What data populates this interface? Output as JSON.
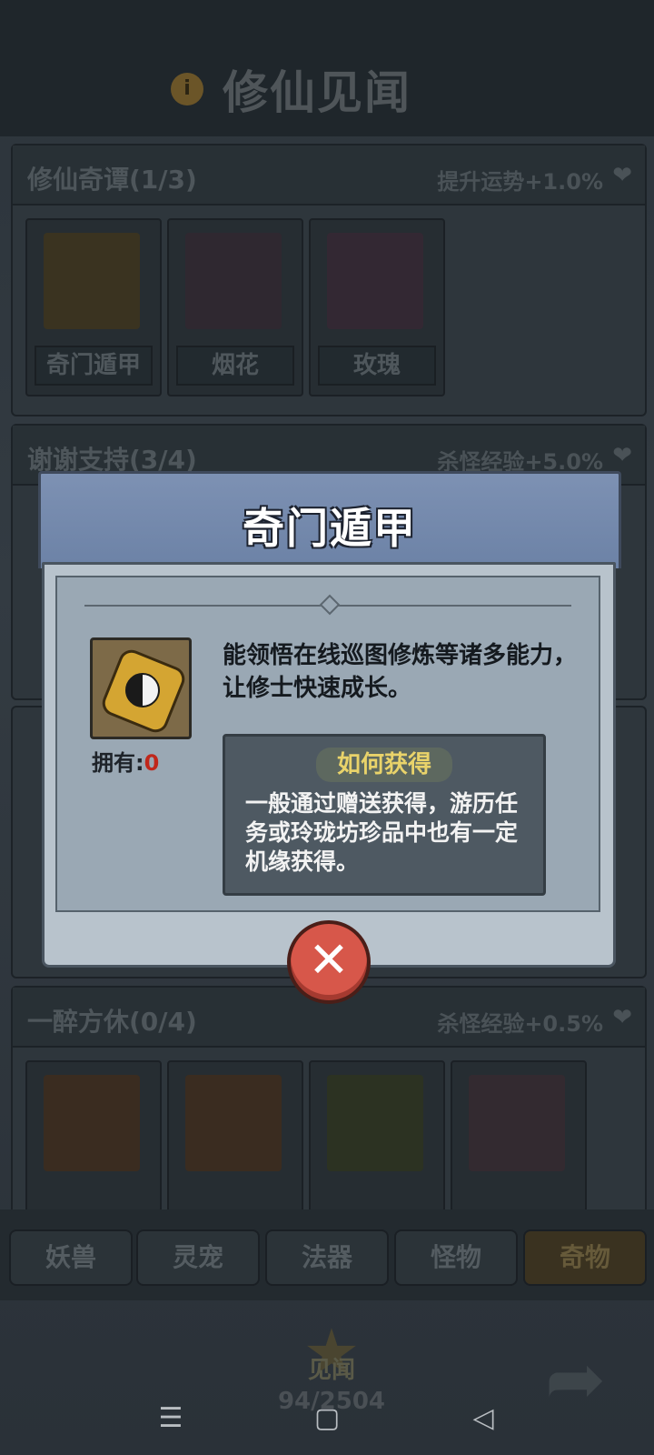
{
  "header": {
    "title": "修仙见闻",
    "info_icon": "info-icon"
  },
  "sections": [
    {
      "title": "修仙奇谭(1/3)",
      "bonus": "提升运势+1.0%",
      "items": [
        "奇门遁甲",
        "烟花",
        "玫瑰"
      ]
    },
    {
      "title": "谢谢支持(3/4)",
      "bonus": "杀怪经验+5.0%",
      "items": []
    },
    {
      "title": "一醉方休(0/4)",
      "bonus": "杀怪经验+0.5%",
      "items": []
    }
  ],
  "tabs": [
    "妖兽",
    "灵宠",
    "法器",
    "怪物",
    "奇物"
  ],
  "active_tab": "奇物",
  "footer": {
    "label": "见闻",
    "progress": "94/2504"
  },
  "modal": {
    "title": "奇门遁甲",
    "owned_label": "拥有:",
    "owned_count": "0",
    "description": "能领悟在线巡图修炼等诸多能力，让修士快速成长。",
    "howto_title": "如何获得",
    "howto_text": "一般通过赠送获得，游历任务或玲珑坊珍品中也有一定机缘获得。",
    "close_icon": "close-icon"
  },
  "colors": {
    "modal_header": "#7d91b3",
    "modal_body": "#b8c3cc",
    "howto_title": "#e9d36a",
    "owned_count": "#c0271b",
    "close_button": "#d7574a"
  }
}
